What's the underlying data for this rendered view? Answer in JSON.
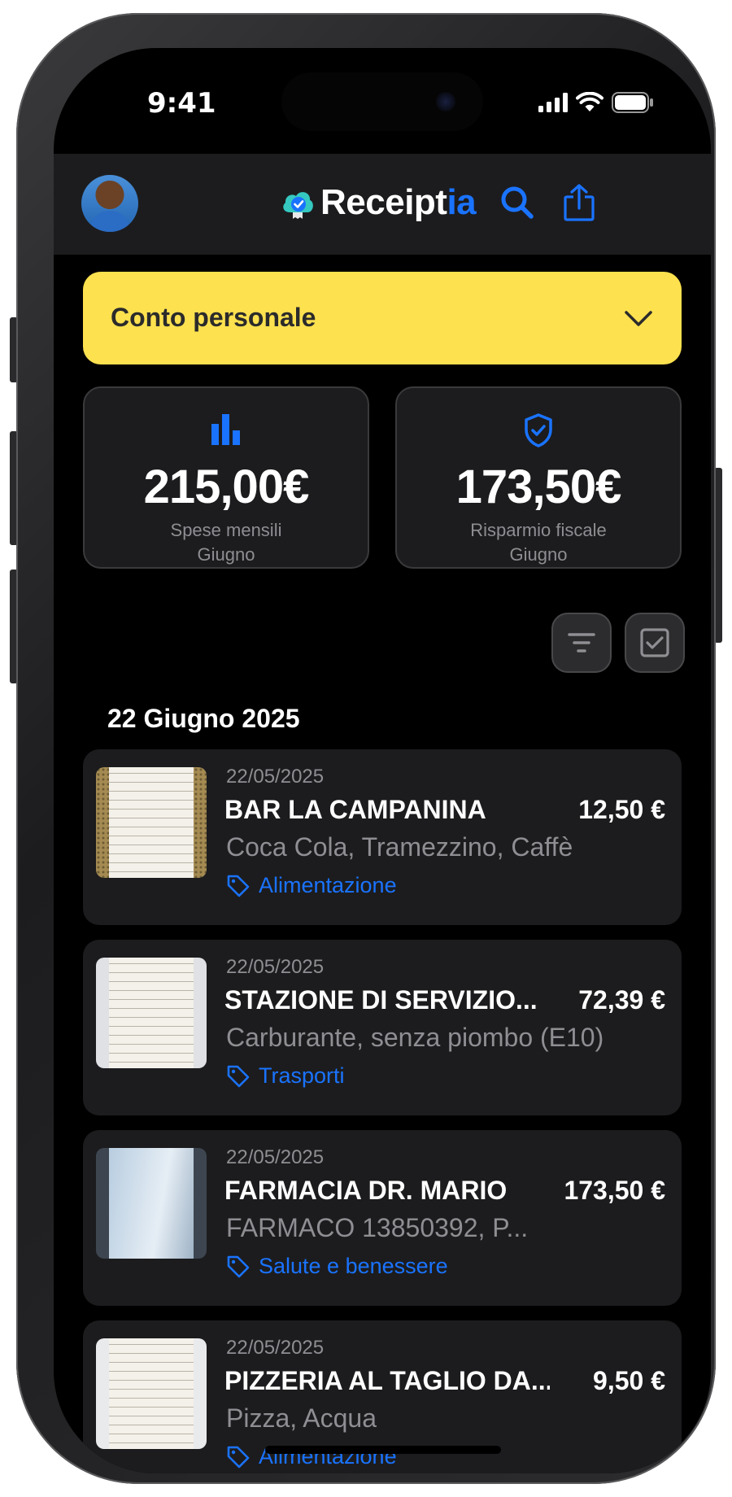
{
  "status_bar": {
    "time": "9:41"
  },
  "header": {
    "logo_main": "Receipt",
    "logo_accent": "ia"
  },
  "account_selector": {
    "label": "Conto personale"
  },
  "stats": [
    {
      "value": "215,00€",
      "label": "Spese mensili",
      "period": "Giugno",
      "icon": "bar-chart-icon"
    },
    {
      "value": "173,50€",
      "label": "Risparmio fiscale",
      "period": "Giugno",
      "icon": "shield-check-icon"
    }
  ],
  "list": {
    "date_header": "22 Giugno 2025",
    "receipts": [
      {
        "date": "22/05/2025",
        "merchant": "BAR LA CAMPANINA",
        "amount": "12,50 €",
        "items": "Coca Cola, Tramezzino, Caffè",
        "category": "Alimentazione"
      },
      {
        "date": "22/05/2025",
        "merchant": "STAZIONE DI SERVIZIO...",
        "amount": "72,39 €",
        "items": "Carburante, senza piombo (E10)",
        "category": "Trasporti"
      },
      {
        "date": "22/05/2025",
        "merchant": "FARMACIA DR. MARIO",
        "amount": "173,50 €",
        "items": "FARMACO 13850392, P...",
        "category": "Salute e benessere"
      },
      {
        "date": "22/05/2025",
        "merchant": "PIZZERIA AL TAGLIO DA...",
        "amount": "9,50 €",
        "items": "Pizza, Acqua",
        "category": "Alimentazione"
      }
    ]
  },
  "colors": {
    "accent": "#1a73ff",
    "account_bg": "#fde14f",
    "card_bg": "#1c1c1e",
    "screen_bg": "#000000"
  }
}
